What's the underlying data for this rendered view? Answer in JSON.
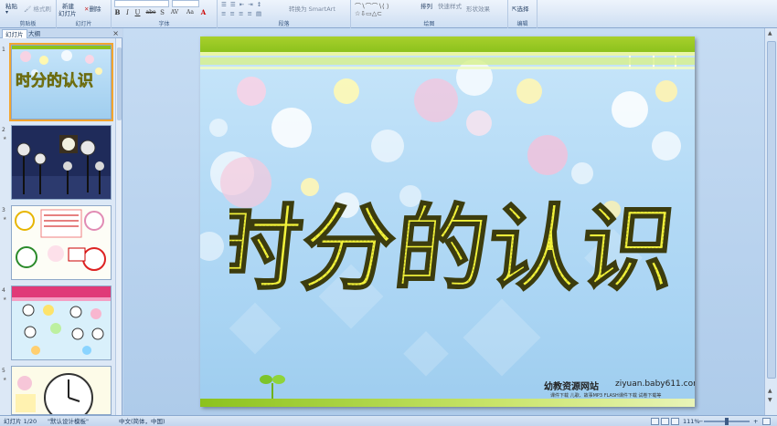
{
  "ribbon": {
    "clipboard": {
      "paste": "粘贴",
      "format_painter": "格式刷",
      "label": "剪贴板"
    },
    "slides": {
      "new_slide_line1": "新建",
      "new_slide_line2": "幻灯片",
      "delete": "删除",
      "label": "幻灯片"
    },
    "font": {
      "bold": "B",
      "italic": "I",
      "underline": "U",
      "strike": "abe",
      "shadow": "S",
      "spacing": "AV",
      "case": "Aa",
      "label": "字体"
    },
    "paragraph": {
      "smartart": "转换为 SmartArt",
      "label": "段落"
    },
    "drawing": {
      "arrange": "排列",
      "quick_styles": "快速样式",
      "shape_effects": "形状效果",
      "label": "绘图"
    },
    "editing": {
      "select": "选择",
      "label": "编辑"
    }
  },
  "panel": {
    "tab_slides": "幻灯片",
    "tab_outline": "大纲",
    "close": "×",
    "thumbs": [
      {
        "num": "1"
      },
      {
        "num": "2"
      },
      {
        "num": "3"
      },
      {
        "num": "4"
      },
      {
        "num": "5"
      }
    ],
    "thumb1_title": "时分的认识"
  },
  "slide": {
    "title": "时分的认识",
    "site_cn": "幼教资源网站",
    "site_en": "ziyuan.baby611.com",
    "site_sub": "课件下载   儿歌、故事MP3   FLASH课件下载   试卷下载等"
  },
  "status": {
    "slide_pos": "幻灯片 1/20",
    "theme": "\"默认设计模板\"",
    "language": "中文(简体，中国)",
    "zoom": "111%"
  },
  "colors": {
    "ribbon_bg": "#dbe7f6",
    "slide_top_green": "#8cc21d",
    "title_yellow": "#f2f23a",
    "selected_outline": "#f3a52e"
  }
}
